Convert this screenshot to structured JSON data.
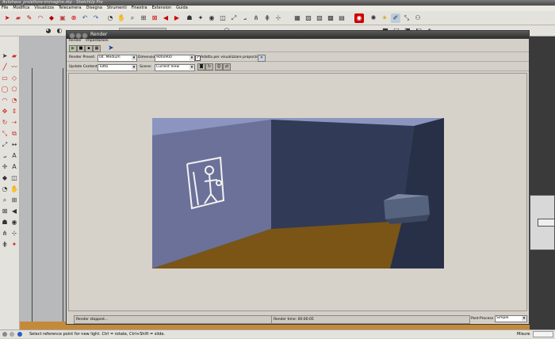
{
  "app": {
    "title": "Autohaus_proiettore-immagine.skp - SketchUp Pro"
  },
  "menu": [
    "File",
    "Modifica",
    "Visualizza",
    "Telecamera",
    "Disegna",
    "Strumenti",
    "Finestra",
    "Extension",
    "Guida"
  ],
  "render_window": {
    "title": "Render",
    "menu": [
      "Render",
      "Impostazioni"
    ],
    "render_preset_label": "Render Preset:",
    "render_preset_value": "04. Medium",
    "dimensioni_label": "Dimensioni",
    "dimensioni_value": "900x900",
    "adatta_checked": true,
    "adatta_label": "Adatta per visualizzare proporzioni",
    "update_content_label": "Update Content:",
    "update_content_value": "Tutto",
    "scene_label": "Scene:",
    "scene_value": "Current View",
    "status_text": "Render stopped...",
    "render_time": "Render time: 00:00:05",
    "post_process_label": "Post-Process",
    "post_process_value": "Simple"
  },
  "statusbar": {
    "hint": "Select reference point for new light. Ctrl = rotate, Ctrl+Shift = slide.",
    "measures_label": "Misure"
  },
  "colors": {
    "wall_left": "#6b7198",
    "wall_back": "#313a56",
    "floor": "#7a5516",
    "ceiling": "#8b95c0"
  }
}
